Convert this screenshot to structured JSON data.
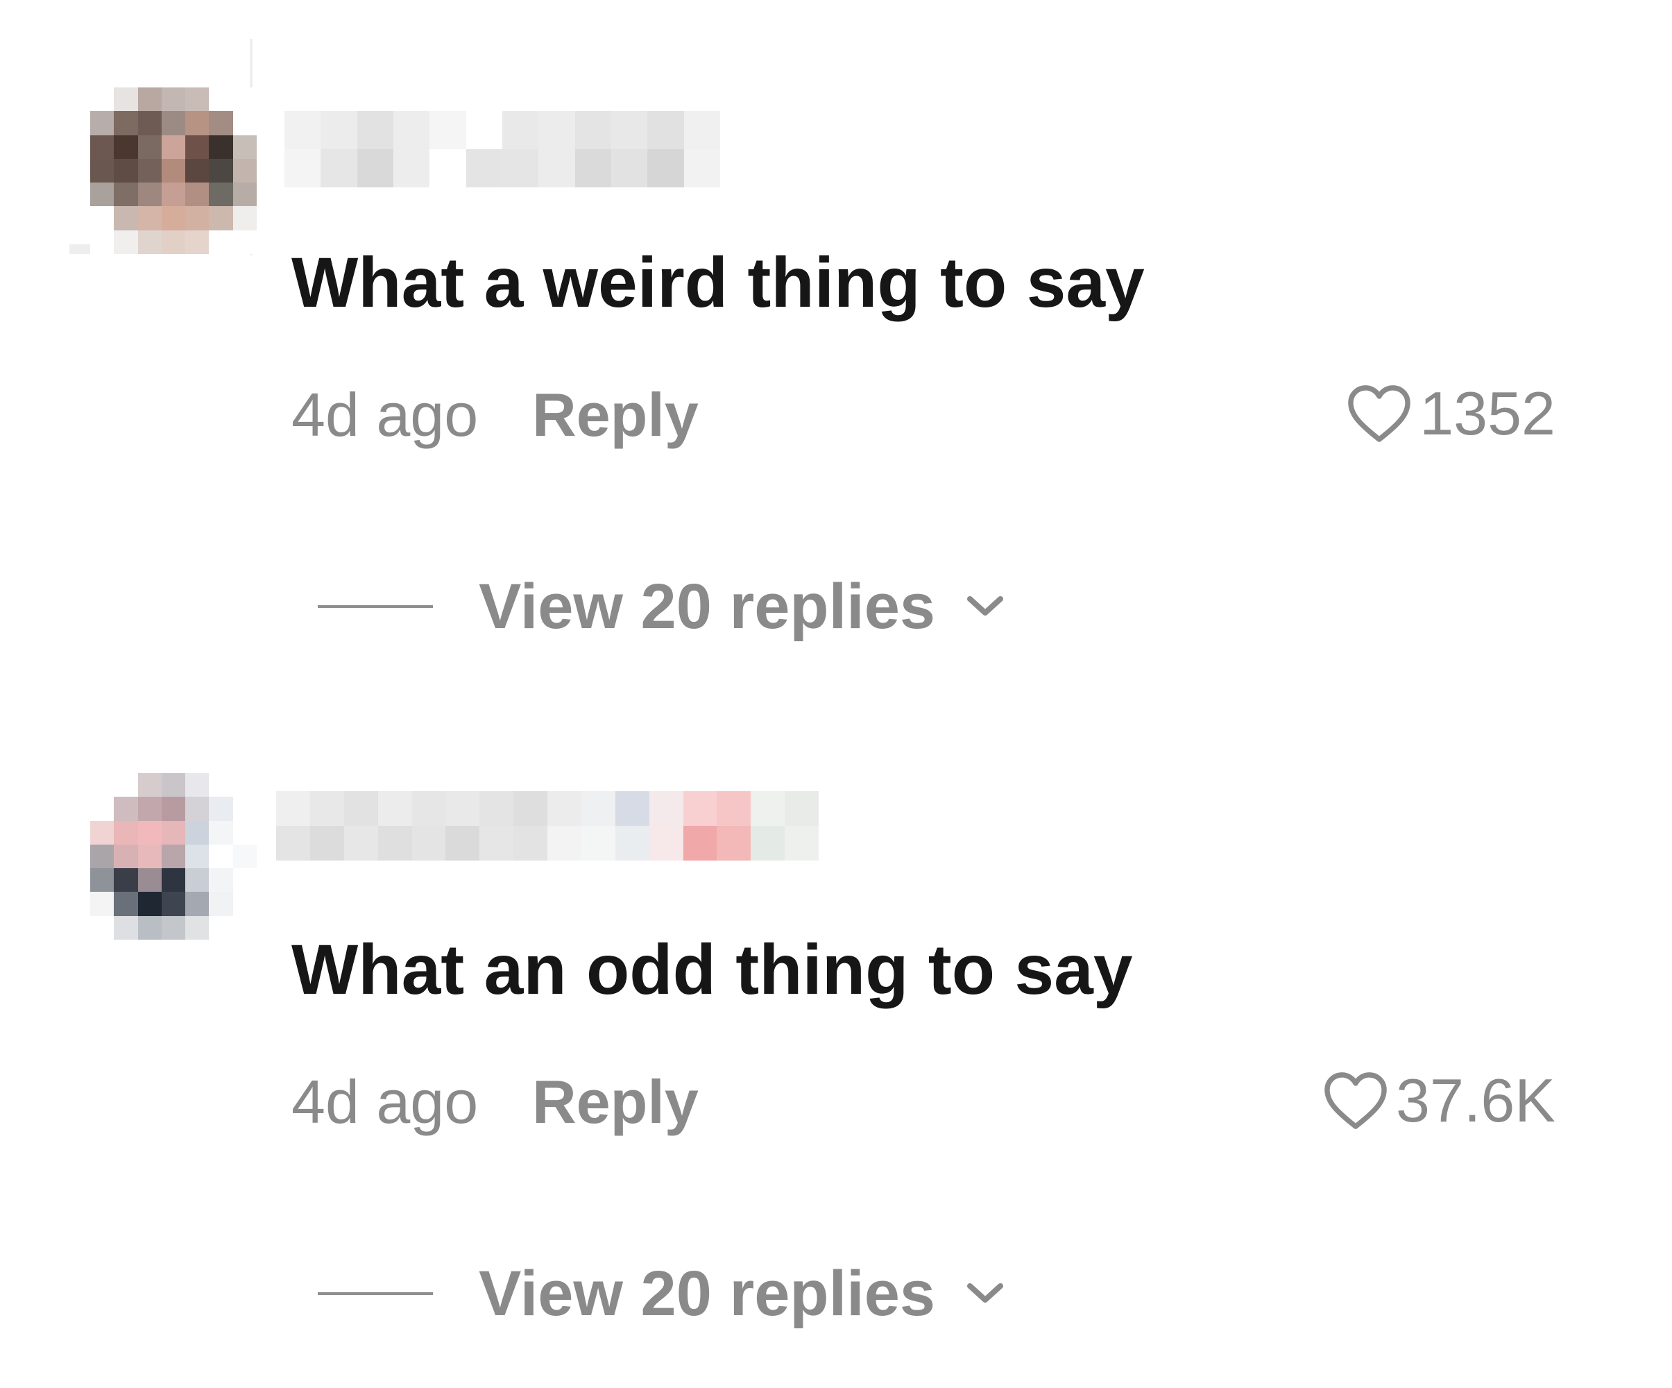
{
  "colors": {
    "text_primary": "#161616",
    "text_secondary": "#8a8a8a",
    "background": "#ffffff"
  },
  "comments": [
    {
      "text": "What a weird thing to say",
      "time": "4d ago",
      "reply_label": "Reply",
      "likes": "1352",
      "like_icon": "heart-outline-icon",
      "view_replies": "View 20 replies",
      "expand_icon": "chevron-down-icon",
      "avatar_pixels": [
        "#ffffff",
        "#e6e3e1",
        "#b9a7a1",
        "#c3b7b3",
        "#c9bcb7",
        "#ffffff",
        "#ffffff",
        "#b7aeab",
        "#7d6a60",
        "#6e5c54",
        "#9c8b84",
        "#b79384",
        "#a38c84",
        "#ffffff",
        "#6c5850",
        "#4a3830",
        "#7b6a62",
        "#cda49a",
        "#6e5249",
        "#3a302c",
        "#c8beb8",
        "#6a5750",
        "#5f4d45",
        "#74625a",
        "#b38b7c",
        "#5b4740",
        "#4c4743",
        "#c3b4ad",
        "#a9a19c",
        "#7e6e66",
        "#9d877e",
        "#c59f93",
        "#b18f82",
        "#6e6a64",
        "#b8ada6",
        "#ffffff",
        "#c9b8b0",
        "#d4b5a8",
        "#d6ad9b",
        "#d2b1a3",
        "#cdb8ae",
        "#f0eeed",
        "#ffffff",
        "#f1efee",
        "#e0d4ce",
        "#e2cfc6",
        "#e4d4cc",
        "#ffffff",
        "#ffffff"
      ],
      "username_blocks": [
        "#f1f1f1",
        "#ececec",
        "#e2e2e2",
        "#ededed",
        "#f5f5f5",
        "#ffffff",
        "#e9e9e9",
        "#ececec",
        "#e4e4e4",
        "#e8e8e8",
        "#e1e1e1",
        "#f0f0f0",
        "#f4f4f4",
        "#e6e6e6",
        "#d9d9d9",
        "#ededed",
        "#ffffff",
        "#e4e4e4",
        "#e5e5e5",
        "#ececec",
        "#dadada",
        "#e2e2e2",
        "#d6d6d6",
        "#f2f2f2"
      ]
    },
    {
      "text": "What an odd thing to say",
      "time": "4d ago",
      "reply_label": "Reply",
      "likes": "37.6K",
      "like_icon": "heart-outline-icon",
      "view_replies": "View 20 replies",
      "expand_icon": "chevron-down-icon",
      "avatar_pixels": [
        "#ffffff",
        "#ffffff",
        "#d6cccd",
        "#c9c5c9",
        "#e8e8ec",
        "#ffffff",
        "#ffffff",
        "#ffffff",
        "#cfbcbf",
        "#c2a8ad",
        "#b89ba1",
        "#d5d2d7",
        "#e9ecf0",
        "#ffffff",
        "#f0d4d4",
        "#eab6b7",
        "#f1b9bb",
        "#e5b7b9",
        "#cdd3dc",
        "#f3f5f7",
        "#ffffff",
        "#a9a5a8",
        "#d8b1b4",
        "#e7b9bb",
        "#b8a6aa",
        "#dde2e8",
        "#ffffff",
        "#f7f8f9",
        "#8e939a",
        "#3a3e48",
        "#9a8c93",
        "#2e3440",
        "#c9ced5",
        "#f3f4f5",
        "#ffffff",
        "#f4f4f5",
        "#6a707a",
        "#1f2733",
        "#3f4550",
        "#a4a9b1",
        "#f1f2f3",
        "#ffffff",
        "#ffffff",
        "#dedfe2",
        "#b9bec5",
        "#c3c6cb",
        "#e1e2e4",
        "#ffffff",
        "#ffffff"
      ],
      "username_blocks": [
        "#efefef",
        "#e8e8e8",
        "#e2e2e2",
        "#ececec",
        "#e6e6e6",
        "#e9e9e9",
        "#e4e4e4",
        "#dedede",
        "#ececec",
        "#eef0f2",
        "#d7dbe6",
        "#f4eaec",
        "#f8d0d1",
        "#f6c6c6",
        "#eef1ee",
        "#e8ebe8",
        "#e4e4e4",
        "#dcdcdc",
        "#e7e7e7",
        "#dfdfdf",
        "#e4e4e4",
        "#dadada",
        "#e6e6e6",
        "#e3e3e3",
        "#f3f3f3",
        "#f4f6f6",
        "#eaedf0",
        "#f7e8e9",
        "#f0a8a8",
        "#f2b9b8",
        "#e4ebe6",
        "#eef0ee"
      ]
    }
  ]
}
